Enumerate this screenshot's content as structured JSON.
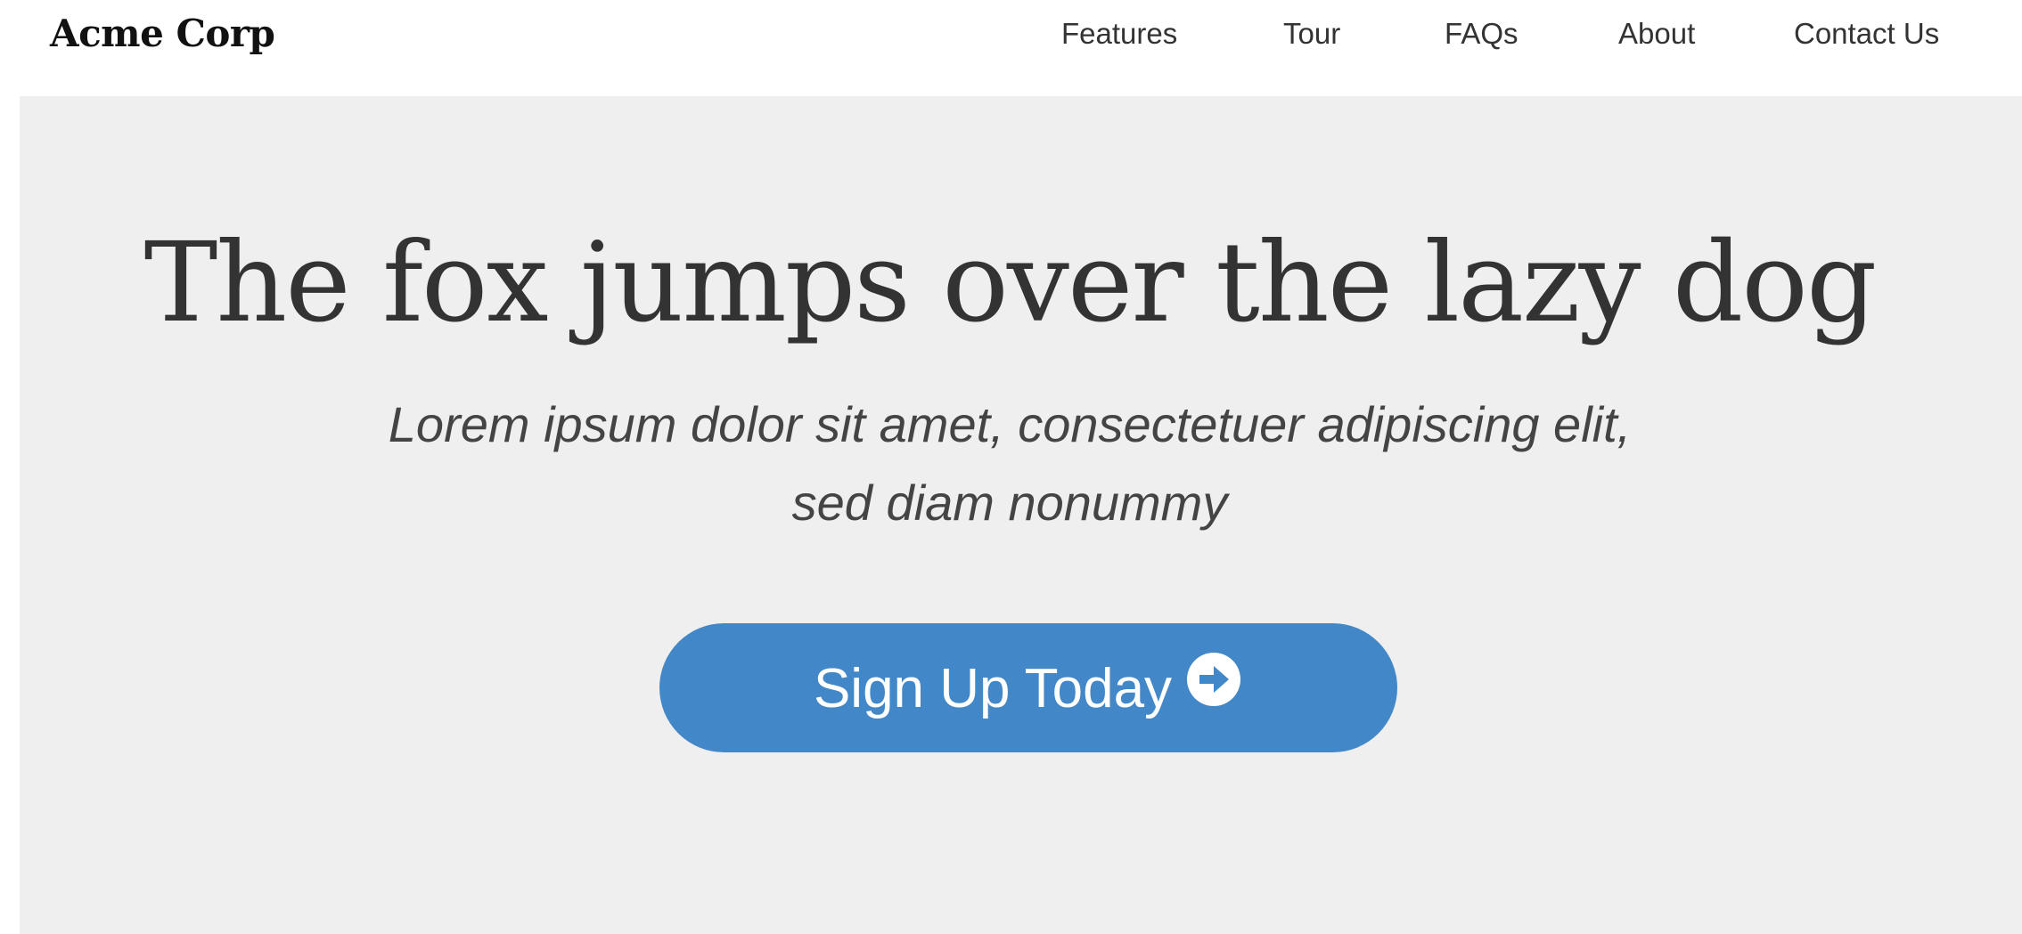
{
  "brand": {
    "name": "Acme Corp"
  },
  "nav": {
    "items": [
      {
        "label": "Features"
      },
      {
        "label": "Tour"
      },
      {
        "label": "FAQs"
      },
      {
        "label": "About"
      },
      {
        "label": "Contact Us"
      }
    ]
  },
  "hero": {
    "title": "The fox jumps over the lazy dog",
    "subtitle_line1": "Lorem ipsum dolor sit amet, consectetuer adipiscing elit,",
    "subtitle_line2": "sed diam nonummy",
    "cta_label": "Sign Up Today",
    "cta_icon": "arrow-right-circle-icon"
  },
  "colors": {
    "hero_background": "#efefef",
    "cta_background": "#4287c8",
    "cta_text": "#ffffff",
    "heading_text": "#333333"
  }
}
